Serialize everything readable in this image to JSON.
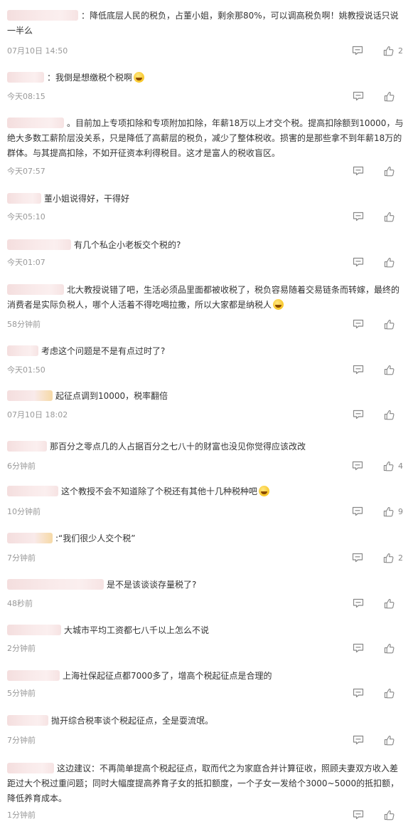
{
  "comments": [
    {
      "text": "：降低底层人民的税负，占董小姐，剩余那80%，可以调高税负啊！姚教授说话只说一半么",
      "time": "07月10日 14:50",
      "likes": "2"
    },
    {
      "text": "：我倒是想缴税个税啊",
      "time": "今天08:15",
      "likes": ""
    },
    {
      "text": "。目前加上专项扣除和专项附加扣除，年薪18万以上才交个税。提高扣除额到10000，与绝大多数工薪阶层没关系，只是降低了高薪层的税负，减少了整体税收。损害的是那些拿不到年薪18万的群体。与其提高扣除，不如开征资本利得税目。这才是富人的税收盲区。",
      "time": "今天07:57",
      "likes": ""
    },
    {
      "text": "董小姐说得好，干得好",
      "time": "今天05:10",
      "likes": ""
    },
    {
      "text": "有几个私企小老板交个税的?",
      "time": "今天01:07",
      "likes": ""
    },
    {
      "text": "北大教授说错了吧，生活必须品里面都被收税了，税负容易随着交易链条而转嫁，最终的消费者是实际负税人，哪个人活着不得吃喝拉撒，所以大家都是纳税人",
      "time": "58分钟前",
      "likes": ""
    },
    {
      "text": "考虑这个问题是不是有点过时了?",
      "time": "今天01:50",
      "likes": ""
    },
    {
      "text": "起征点调到10000，税率翻倍",
      "time": "07月10日 18:02",
      "likes": ""
    },
    {
      "text": "那百分之零点几的人占据百分之七八十的财富也没见你觉得应该改改",
      "time": "6分钟前",
      "likes": "4"
    },
    {
      "text": "这个教授不会不知道除了个税还有其他十几种税种吧",
      "time": "10分钟前",
      "likes": "9"
    },
    {
      "text": ":“我们很少人交个税”",
      "time": "7分钟前",
      "likes": "2"
    },
    {
      "text": "是不是该谈谈存量税了?",
      "time": "48秒前",
      "likes": ""
    },
    {
      "text": "大城市平均工资都七八千以上怎么不说",
      "time": "2分钟前",
      "likes": ""
    },
    {
      "text": "上海社保起征点都7000多了，增高个税起征点是合理的",
      "time": "5分钟前",
      "likes": ""
    },
    {
      "text": "抛开综合税率谈个税起征点，全是耍流氓。",
      "time": "7分钟前",
      "likes": ""
    },
    {
      "text": "这边建议：不再简单提高个税起征点，取而代之为家庭合并计算征收，照顾夫妻双方收入差距过大个税过重问题；同时大幅度提高养育子女的抵扣额度，一个子女一发给个3000~5000的抵扣额，降低养育成本。",
      "time": "1分钟前",
      "likes": ""
    }
  ],
  "icons": {
    "reply": "comment-reply-icon",
    "like": "thumbs-up-icon"
  },
  "colors": {
    "text": "#333333",
    "time": "#999999",
    "icon": "#888888",
    "blur": "#f6e3e3"
  }
}
